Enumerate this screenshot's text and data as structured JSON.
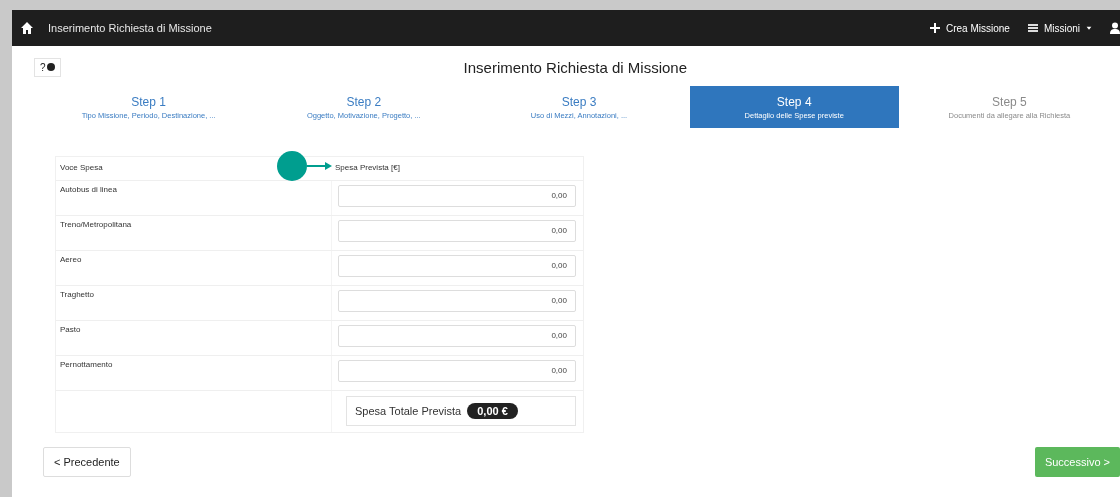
{
  "navbar": {
    "title": "Inserimento Richiesta di Missione",
    "actions": [
      {
        "kind": "plus",
        "label": "Crea Missione"
      },
      {
        "kind": "menu",
        "label": "Missioni"
      }
    ]
  },
  "help": {
    "label": "?"
  },
  "page_title": "Inserimento Richiesta di Missione",
  "steps": [
    {
      "title": "Step 1",
      "subtitle": "Tipo Missione, Periodo, Destinazione, ...",
      "selected": false,
      "disabled": false
    },
    {
      "title": "Step 2",
      "subtitle": "Oggetto, Motivazione, Progetto, ...",
      "selected": false,
      "disabled": false
    },
    {
      "title": "Step 3",
      "subtitle": "Uso di Mezzi, Annotazioni, ...",
      "selected": false,
      "disabled": false
    },
    {
      "title": "Step 4",
      "subtitle": "Dettaglio delle Spese previste",
      "selected": true,
      "disabled": false
    },
    {
      "title": "Step 5",
      "subtitle": "Documenti da allegare alla Richiesta",
      "selected": false,
      "disabled": true
    }
  ],
  "table": {
    "columns": [
      "Voce Spesa",
      "Spesa Prevista [€]"
    ],
    "rows": [
      {
        "label": "Autobus di linea",
        "value": "0,00"
      },
      {
        "label": "Treno/Metropolitana",
        "value": "0,00"
      },
      {
        "label": "Aereo",
        "value": "0,00"
      },
      {
        "label": "Traghetto",
        "value": "0,00"
      },
      {
        "label": "Pasto",
        "value": "0,00"
      },
      {
        "label": "Pernottamento",
        "value": "0,00"
      }
    ],
    "total_label": "Spesa Totale Prevista",
    "total_value": "0,00 €"
  },
  "buttons": {
    "previous": "< Precedente",
    "next": "Successivo >"
  }
}
